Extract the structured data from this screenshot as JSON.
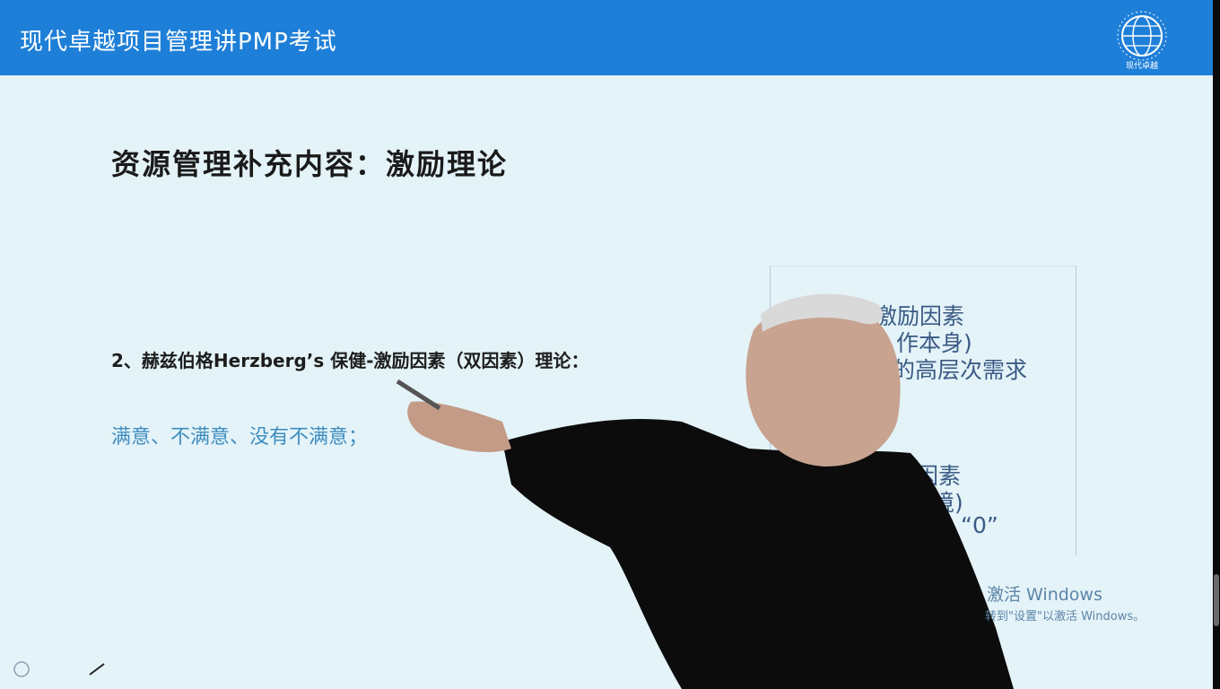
{
  "header": {
    "channel_title": "现代卓越项目管理讲PMP考试",
    "logo_text": "现代卓越"
  },
  "slide": {
    "heading": "资源管理补充内容：激励理论",
    "point": "2、赫兹伯格Herzberg’s 保健-激励因素（双因素）理论：",
    "sub": "满意、不满意、没有不满意；",
    "box_lines": [
      "激励因素",
      "作本身)",
      "的高层次需求",
      "因素",
      "境)",
      "“0”"
    ]
  },
  "overlay": {
    "activate_title": "激活 Windows",
    "activate_hint": "转到\"设置\"以激活 Windows。"
  },
  "colors": {
    "header_bg": "#1e7fd8",
    "slide_bg": "#e4f3f8",
    "accent_text": "#3f8dc0",
    "box_text": "#3a5a84"
  }
}
